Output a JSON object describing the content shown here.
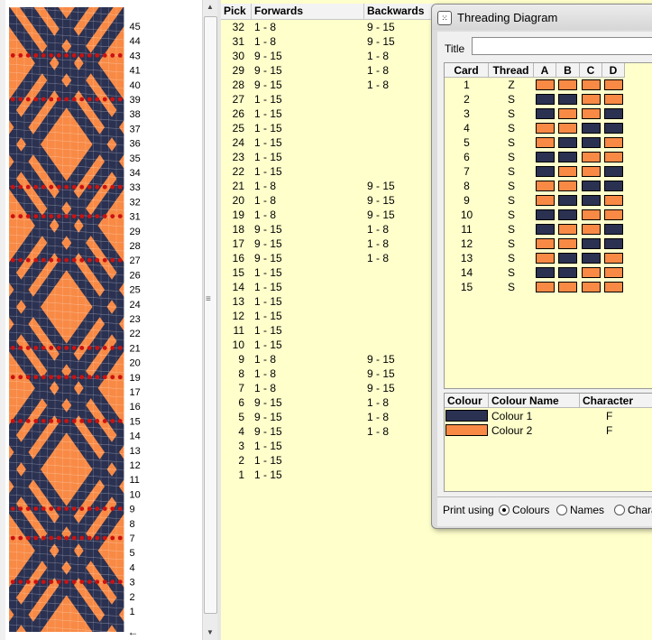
{
  "colors": {
    "colour1": "#2b3151",
    "colour2": "#f88a45",
    "marker": "#cc1111",
    "grid_bg": "#ffffcc"
  },
  "band": {
    "row_numbers": [
      "45",
      "44",
      "43",
      "41",
      "40",
      "39",
      "38",
      "37",
      "36",
      "35",
      "34",
      "33",
      "32",
      "31",
      "29",
      "28",
      "27",
      "26",
      "25",
      "24",
      "23",
      "22",
      "21",
      "20",
      "19",
      "17",
      "16",
      "15",
      "14",
      "13",
      "12",
      "11",
      "10",
      "9",
      "8",
      "7",
      "5",
      "4",
      "3",
      "2",
      "1"
    ],
    "marked_rows": [
      "43",
      "39",
      "33",
      "31",
      "27",
      "21",
      "19",
      "15",
      "9",
      "7",
      "3"
    ],
    "bottom_arrow": "←"
  },
  "scrollbar": {
    "up_icon": "triangle-up-icon",
    "down_icon": "triangle-down-icon",
    "grip_icon": "grip-icon"
  },
  "pick_table": {
    "headers": {
      "pick": "Pick",
      "forwards": "Forwards",
      "backwards": "Backwards"
    },
    "rows": [
      {
        "pick": "32",
        "fwd": "1 - 8",
        "bwd": "9 - 15"
      },
      {
        "pick": "31",
        "fwd": "1 - 8",
        "bwd": "9 - 15"
      },
      {
        "pick": "30",
        "fwd": "9 - 15",
        "bwd": "1 - 8"
      },
      {
        "pick": "29",
        "fwd": "9 - 15",
        "bwd": "1 - 8"
      },
      {
        "pick": "28",
        "fwd": "9 - 15",
        "bwd": "1 - 8"
      },
      {
        "pick": "27",
        "fwd": "1 - 15",
        "bwd": ""
      },
      {
        "pick": "26",
        "fwd": "1 - 15",
        "bwd": ""
      },
      {
        "pick": "25",
        "fwd": "1 - 15",
        "bwd": ""
      },
      {
        "pick": "24",
        "fwd": "1 - 15",
        "bwd": ""
      },
      {
        "pick": "23",
        "fwd": "1 - 15",
        "bwd": ""
      },
      {
        "pick": "22",
        "fwd": "1 - 15",
        "bwd": ""
      },
      {
        "pick": "21",
        "fwd": "1 - 8",
        "bwd": "9 - 15"
      },
      {
        "pick": "20",
        "fwd": "1 - 8",
        "bwd": "9 - 15"
      },
      {
        "pick": "19",
        "fwd": "1 - 8",
        "bwd": "9 - 15"
      },
      {
        "pick": "18",
        "fwd": "9 - 15",
        "bwd": "1 - 8"
      },
      {
        "pick": "17",
        "fwd": "9 - 15",
        "bwd": "1 - 8"
      },
      {
        "pick": "16",
        "fwd": "9 - 15",
        "bwd": "1 - 8"
      },
      {
        "pick": "15",
        "fwd": "1 - 15",
        "bwd": ""
      },
      {
        "pick": "14",
        "fwd": "1 - 15",
        "bwd": ""
      },
      {
        "pick": "13",
        "fwd": "1 - 15",
        "bwd": ""
      },
      {
        "pick": "12",
        "fwd": "1 - 15",
        "bwd": ""
      },
      {
        "pick": "11",
        "fwd": "1 - 15",
        "bwd": ""
      },
      {
        "pick": "10",
        "fwd": "1 - 15",
        "bwd": ""
      },
      {
        "pick": "9",
        "fwd": "1 - 8",
        "bwd": "9 - 15"
      },
      {
        "pick": "8",
        "fwd": "1 - 8",
        "bwd": "9 - 15"
      },
      {
        "pick": "7",
        "fwd": "1 - 8",
        "bwd": "9 - 15"
      },
      {
        "pick": "6",
        "fwd": "9 - 15",
        "bwd": "1 - 8"
      },
      {
        "pick": "5",
        "fwd": "9 - 15",
        "bwd": "1 - 8"
      },
      {
        "pick": "4",
        "fwd": "9 - 15",
        "bwd": "1 - 8"
      },
      {
        "pick": "3",
        "fwd": "1 - 15",
        "bwd": ""
      },
      {
        "pick": "2",
        "fwd": "1 - 15",
        "bwd": ""
      },
      {
        "pick": "1",
        "fwd": "1 - 15",
        "bwd": ""
      }
    ]
  },
  "dialog": {
    "title": "Threading Diagram",
    "icon": "dialog-app-icon",
    "title_label": "Title",
    "title_value": "",
    "card_headers": {
      "card": "Card",
      "thread": "Thread",
      "a": "A",
      "b": "B",
      "c": "C",
      "d": "D"
    },
    "cards": [
      {
        "card": "1",
        "thread": "Z",
        "holes": [
          2,
          2,
          2,
          2
        ]
      },
      {
        "card": "2",
        "thread": "S",
        "holes": [
          1,
          1,
          2,
          2
        ]
      },
      {
        "card": "3",
        "thread": "S",
        "holes": [
          1,
          2,
          2,
          1
        ]
      },
      {
        "card": "4",
        "thread": "S",
        "holes": [
          2,
          2,
          1,
          1
        ]
      },
      {
        "card": "5",
        "thread": "S",
        "holes": [
          2,
          1,
          1,
          2
        ]
      },
      {
        "card": "6",
        "thread": "S",
        "holes": [
          1,
          1,
          2,
          2
        ]
      },
      {
        "card": "7",
        "thread": "S",
        "holes": [
          1,
          2,
          2,
          1
        ]
      },
      {
        "card": "8",
        "thread": "S",
        "holes": [
          2,
          2,
          1,
          1
        ]
      },
      {
        "card": "9",
        "thread": "S",
        "holes": [
          2,
          1,
          1,
          2
        ]
      },
      {
        "card": "10",
        "thread": "S",
        "holes": [
          1,
          1,
          2,
          2
        ]
      },
      {
        "card": "11",
        "thread": "S",
        "holes": [
          1,
          2,
          2,
          1
        ]
      },
      {
        "card": "12",
        "thread": "S",
        "holes": [
          2,
          2,
          1,
          1
        ]
      },
      {
        "card": "13",
        "thread": "S",
        "holes": [
          2,
          1,
          1,
          2
        ]
      },
      {
        "card": "14",
        "thread": "S",
        "holes": [
          1,
          1,
          2,
          2
        ]
      },
      {
        "card": "15",
        "thread": "S",
        "holes": [
          2,
          2,
          2,
          2
        ]
      }
    ],
    "colour_headers": {
      "colour": "Colour",
      "name": "Colour Name",
      "character": "Character"
    },
    "colours": [
      {
        "name": "Colour 1",
        "character": "F",
        "color": "#2b3151"
      },
      {
        "name": "Colour 2",
        "character": "F",
        "color": "#f88a45"
      }
    ],
    "print_label": "Print using",
    "print_options": [
      {
        "label": "Colours",
        "selected": true
      },
      {
        "label": "Names",
        "selected": false
      },
      {
        "label": "Characters",
        "selected": false
      }
    ]
  }
}
